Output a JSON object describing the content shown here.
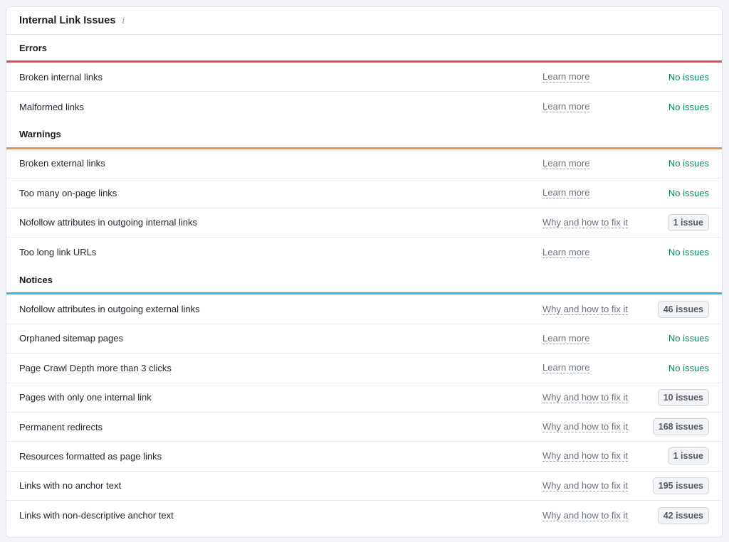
{
  "title": "Internal Link Issues",
  "info_icon": "i",
  "colors": {
    "errors": "#f0474f",
    "warnings": "#f2904a",
    "notices": "#37b6ec",
    "ok": "#0a8a5f"
  },
  "sections": [
    {
      "name": "Errors",
      "color": "#f0474f",
      "rows": [
        {
          "label": "Broken internal links",
          "link": "Learn more",
          "status": "No issues",
          "is_issue": false
        },
        {
          "label": "Malformed links",
          "link": "Learn more",
          "status": "No issues",
          "is_issue": false
        }
      ]
    },
    {
      "name": "Warnings",
      "color": "#f2904a",
      "rows": [
        {
          "label": "Broken external links",
          "link": "Learn more",
          "status": "No issues",
          "is_issue": false
        },
        {
          "label": "Too many on-page links",
          "link": "Learn more",
          "status": "No issues",
          "is_issue": false
        },
        {
          "label": "Nofollow attributes in outgoing internal links",
          "link": "Why and how to fix it",
          "status": "1 issue",
          "is_issue": true
        },
        {
          "label": "Too long link URLs",
          "link": "Learn more",
          "status": "No issues",
          "is_issue": false
        }
      ]
    },
    {
      "name": "Notices",
      "color": "#37b6ec",
      "rows": [
        {
          "label": "Nofollow attributes in outgoing external links",
          "link": "Why and how to fix it",
          "status": "46 issues",
          "is_issue": true
        },
        {
          "label": "Orphaned sitemap pages",
          "link": "Learn more",
          "status": "No issues",
          "is_issue": false
        },
        {
          "label": "Page Crawl Depth more than 3 clicks",
          "link": "Learn more",
          "status": "No issues",
          "is_issue": false
        },
        {
          "label": "Pages with only one internal link",
          "link": "Why and how to fix it",
          "status": "10 issues",
          "is_issue": true
        },
        {
          "label": "Permanent redirects",
          "link": "Why and how to fix it",
          "status": "168 issues",
          "is_issue": true
        },
        {
          "label": "Resources formatted as page links",
          "link": "Why and how to fix it",
          "status": "1 issue",
          "is_issue": true
        },
        {
          "label": "Links with no anchor text",
          "link": "Why and how to fix it",
          "status": "195 issues",
          "is_issue": true
        },
        {
          "label": "Links with non-descriptive anchor text",
          "link": "Why and how to fix it",
          "status": "42 issues",
          "is_issue": true
        }
      ]
    }
  ]
}
